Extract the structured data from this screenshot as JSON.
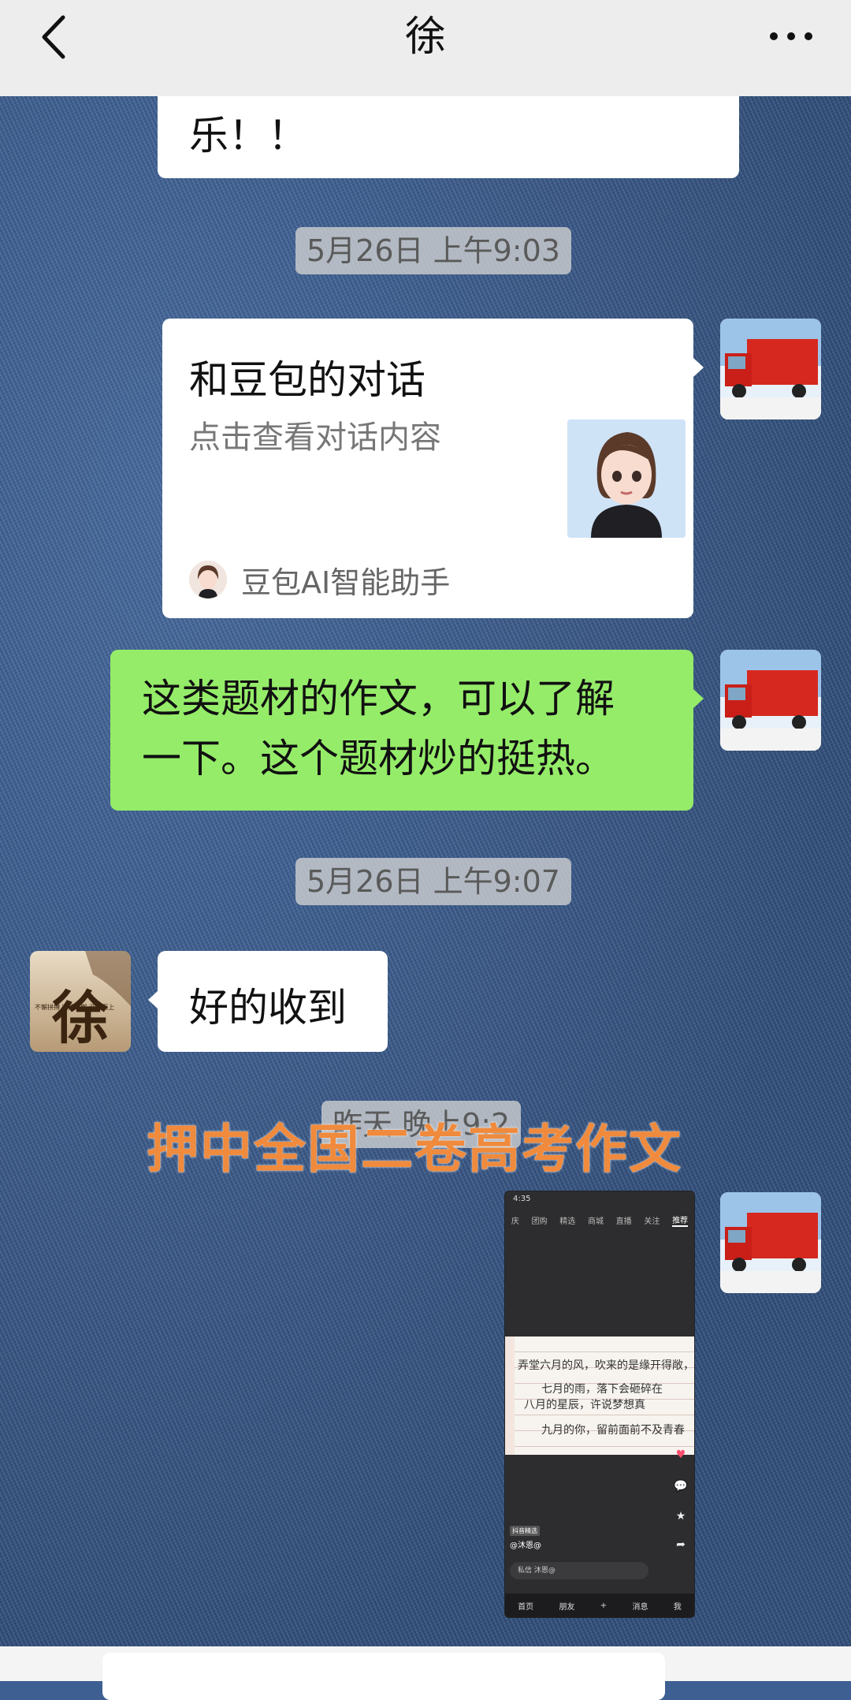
{
  "header": {
    "title": "徐"
  },
  "messages": {
    "partial_text": "乐！！",
    "timestamp_1": "5月26日 上午9:03",
    "card": {
      "title": "和豆包的对话",
      "subtitle": "点击查看对话内容",
      "source": "豆包AI智能助手"
    },
    "green_text_line1": "这类题材的作文，可以了解",
    "green_text_line2": "一下。这个题材炒的挺热。",
    "timestamp_2": "5月26日 上午9:07",
    "reply_text": "好的收到",
    "timestamp_3_partial": "昨天 晚上9:2",
    "contact_avatar_glyph": "徐",
    "contact_avatar_subtext": "不懈拼搏 坚持不懈 迎难而上"
  },
  "overlay": {
    "caption": "押中全国二卷高考作文",
    "color": "#f08a3c"
  },
  "screenshot": {
    "status_time": "4:35",
    "tabs": [
      "庆",
      "团购",
      "精选",
      "商城",
      "直播",
      "关注",
      "推荐"
    ],
    "active_tab": "推荐",
    "handwriting": [
      "弄堂六月的风，吹来的是缘开得敞，",
      "七月的雨，落下会砸碎在",
      "八月的星辰，许说梦想真",
      "九月的你，留前面前不及青春"
    ],
    "tag": "抖音精选",
    "username": "@沐恩@",
    "input_placeholder": "私信 沐恩@",
    "nav": [
      "首页",
      "朋友",
      "+",
      "消息",
      "我"
    ]
  },
  "colors": {
    "header_bg": "#ededed",
    "green_bubble": "#95ec69",
    "white_bubble": "#ffffff",
    "timestamp_bg": "#d2d2d2"
  }
}
